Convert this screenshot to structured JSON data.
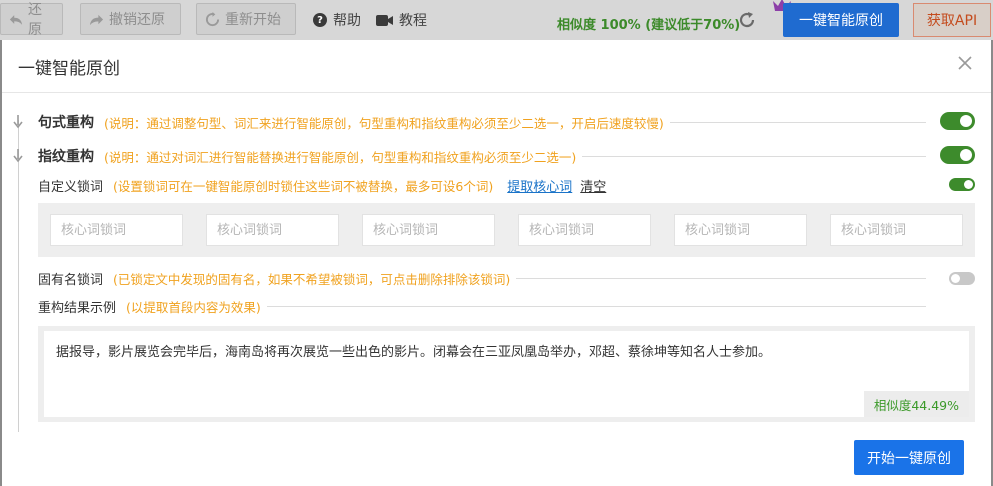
{
  "toolbar": {
    "undo": "还原",
    "redo": "撤销还原",
    "restart": "重新开始",
    "help": "帮助",
    "tutorial": "教程",
    "similarity": "相似度 100% (建议低于70%)",
    "original_button": "一键智能原创",
    "api_button": "获取API"
  },
  "modal": {
    "title": "一键智能原创",
    "sentence_rebuild": {
      "title": "句式重构",
      "note": "(说明：通过调整句型、词汇来进行智能原创，句型重构和指纹重构必须至少二选一，开启后速度较慢)",
      "enabled": true
    },
    "fingerprint_rebuild": {
      "title": "指纹重构",
      "note": "(说明：通过对词汇进行智能替换进行智能原创，句型重构和指纹重构必须至少二选一)",
      "enabled": true
    },
    "custom_lock": {
      "label": "自定义锁词",
      "note": "(设置锁词可在一键智能原创时锁住这些词不被替换，最多可设6个词)",
      "extract_link": "提取核心词",
      "clear_link": "清空",
      "enabled": true,
      "placeholder": "核心词锁词"
    },
    "proper_noun_lock": {
      "label": "固有名锁词",
      "note": "(已锁定文中发现的固有名，如果不希望被锁词，可点击删除排除该锁词)",
      "enabled": false
    },
    "result_example": {
      "label": "重构结果示例",
      "note": "(以提取首段内容为效果)",
      "text": "据报导，影片展览会完毕后，海南岛将再次展览一些出色的影片。闭幕会在三亚凤凰岛举办，邓超、蔡徐坤等知名人士参加。",
      "similarity": "相似度44.49%"
    },
    "start_button": "开始一键原创"
  },
  "colors": {
    "accent_blue": "#1a73e8",
    "toggle_green": "#3d8b2c",
    "note_orange": "#f0a21f"
  }
}
